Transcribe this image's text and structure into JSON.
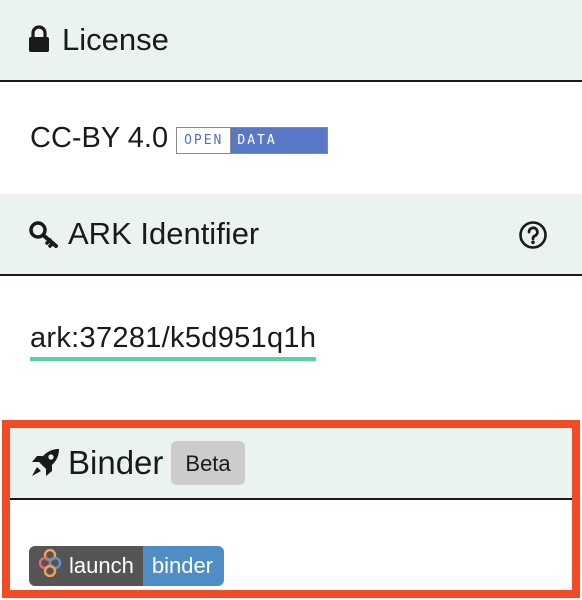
{
  "license": {
    "header": "License",
    "header_icon": "lock-icon",
    "value": "CC-BY 4.0",
    "badge": {
      "left": "OPEN",
      "right": "DATA"
    }
  },
  "ark": {
    "header": "ARK Identifier",
    "header_icon": "key-icon",
    "help_icon": "question-circle-icon",
    "identifier": "ark:37281/k5d951q1h",
    "underline_color": "#5cd39a"
  },
  "binder": {
    "header": "Binder",
    "header_icon": "rocket-icon",
    "badge": "Beta",
    "launch_left": "launch",
    "launch_right": "binder",
    "highlight_color": "#f04a26"
  }
}
